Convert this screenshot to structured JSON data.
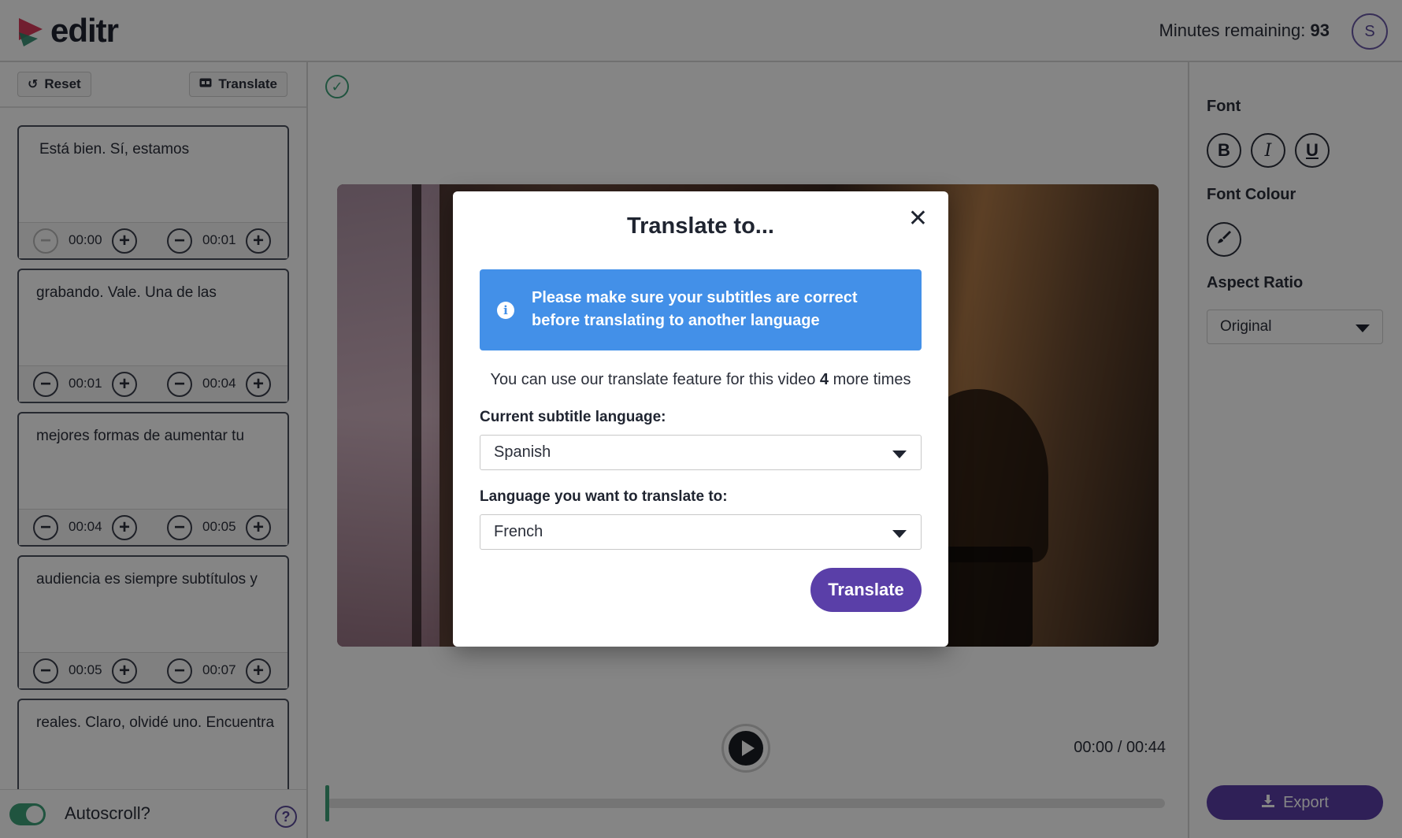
{
  "header": {
    "logo_text": "editr",
    "minutes_label": "Minutes remaining:",
    "minutes_value": "93",
    "avatar_initial": "S"
  },
  "left_toolbar": {
    "reset_label": "Reset",
    "translate_label": "Translate"
  },
  "subtitles": [
    {
      "text": "Está bien. Sí, estamos",
      "start": "00:00",
      "end": "00:01"
    },
    {
      "text": "grabando. Vale. Una de las",
      "start": "00:01",
      "end": "00:04"
    },
    {
      "text": "mejores formas de aumentar tu",
      "start": "00:04",
      "end": "00:05"
    },
    {
      "text": "audiencia es siempre subtítulos y",
      "start": "00:05",
      "end": "00:07"
    },
    {
      "text": "reales. Claro, olvidé uno. Encuentra"
    }
  ],
  "left_footer": {
    "autoscroll_label": "Autoscroll?",
    "autoscroll_on": true,
    "help_glyph": "?"
  },
  "player": {
    "timecode": "00:00 / 00:44",
    "progress": 0
  },
  "right_panel": {
    "font_label": "Font",
    "bold_glyph": "B",
    "italic_glyph": "I",
    "underline_glyph": "U",
    "font_colour_label": "Font Colour",
    "aspect_label": "Aspect Ratio",
    "aspect_value": "Original",
    "export_label": "Export"
  },
  "modal": {
    "title": "Translate to...",
    "close_glyph": "✕",
    "info_text": "Please make sure your subtitles are correct before translating to another language",
    "usage_prefix": "You can use our translate feature for this video",
    "usage_count": "4",
    "usage_suffix": "more times",
    "current_label": "Current subtitle language:",
    "current_value": "Spanish",
    "target_label": "Language you want to translate to:",
    "target_value": "French",
    "translate_button": "Translate"
  },
  "colors": {
    "brand_purple": "#5a3fa8",
    "info_blue": "#4390e8",
    "accent_green": "#3fa27a",
    "logo_red": "#d83a5a",
    "logo_teal": "#2a8a6a"
  },
  "icons": {
    "logo": "editr-logo-mark",
    "reset": "undo-icon",
    "translate": "translate-icon",
    "minus": "minus-circle-icon",
    "plus": "plus-circle-icon",
    "check": "check-circle-icon",
    "play": "play-icon",
    "colour": "paintbrush-icon",
    "dropdown": "chevron-down-icon",
    "export": "download-icon",
    "info": "info-icon",
    "close": "close-icon",
    "help": "help-icon"
  }
}
